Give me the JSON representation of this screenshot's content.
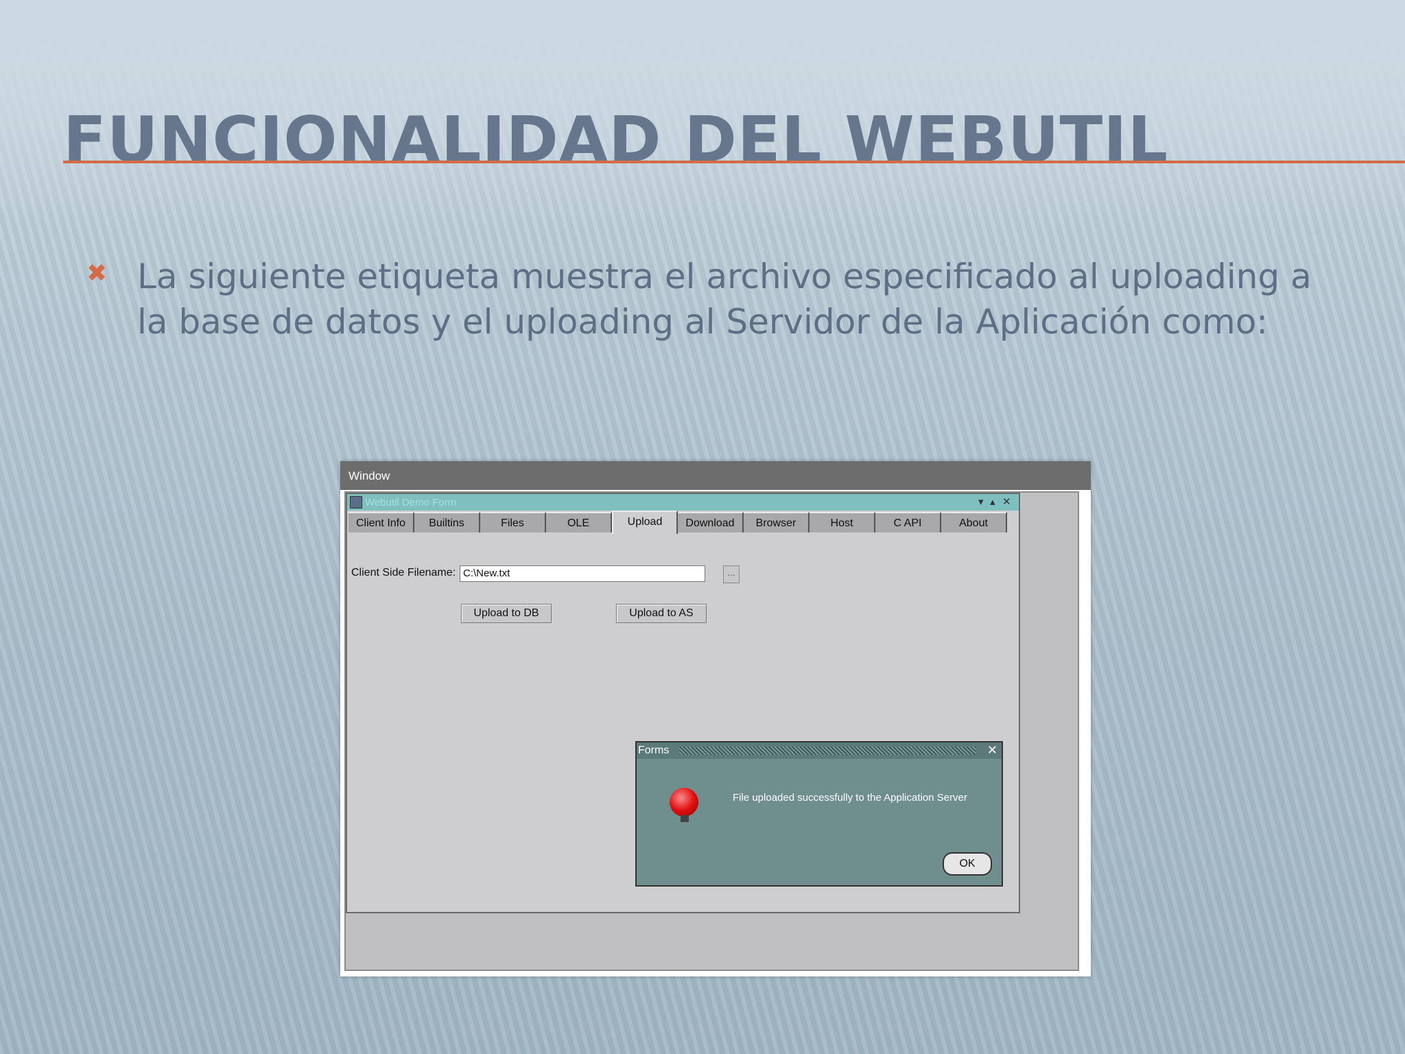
{
  "slide": {
    "title": "FUNCIONALIDAD DEL WEBUTIL",
    "bullet_icon": "x-mark-icon",
    "bullet_text": "La siguiente etiqueta muestra el archivo especificado al uploading a la base de datos y el uploading al Servidor de la Aplicación como:",
    "accent_color": "#d56b46",
    "title_color": "#66768d"
  },
  "screenshot": {
    "menubar": {
      "window_menu": "Window"
    },
    "form": {
      "title": "Webutil Demo Form",
      "tabs": [
        {
          "label": "Client Info"
        },
        {
          "label": "Builtins"
        },
        {
          "label": "Files"
        },
        {
          "label": "OLE"
        },
        {
          "label": "Upload",
          "active": true
        },
        {
          "label": "Download"
        },
        {
          "label": "Browser"
        },
        {
          "label": "Host"
        },
        {
          "label": "C API"
        },
        {
          "label": "About"
        }
      ],
      "filename_label": "Client Side Filename:",
      "filename_value": "C:\\New.txt",
      "browse_label": "...",
      "upload_db_label": "Upload to DB",
      "upload_as_label": "Upload to AS"
    },
    "dialog": {
      "title": "Forms",
      "message": "File uploaded successfully to the Application Server",
      "ok_label": "OK",
      "icon": "alarm-bell-icon"
    }
  }
}
